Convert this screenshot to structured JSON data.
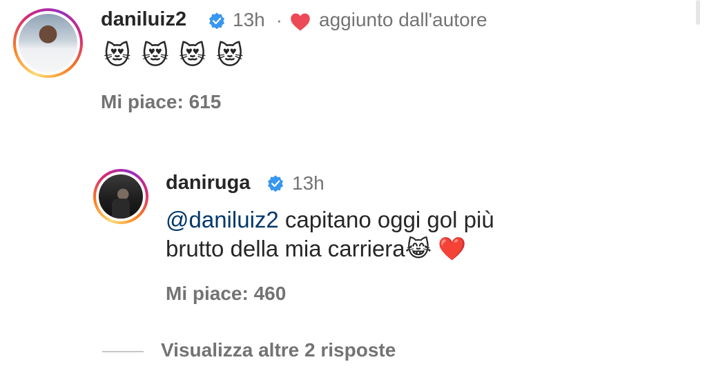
{
  "comment": {
    "username": "daniluiz2",
    "time": "13h",
    "separator": "·",
    "author_tag": "aggiunto dall'autore",
    "emojis": [
      "😻",
      "😻",
      "😻",
      "😻"
    ],
    "likes": "Mi piace: 615"
  },
  "reply": {
    "username": "daniruga",
    "time": "13h",
    "mention": "@daniluiz2",
    "text_line1": " capitano oggi gol più",
    "text_line2": "brutto della mia carriera",
    "emoji_laugh": "😹",
    "emoji_heart": "❤️",
    "likes": "Mi piace: 460"
  },
  "view_more": "Visualizza altre 2 risposte",
  "colors": {
    "verified": "#3897f0",
    "heart": "#ed4956",
    "link": "#00376b",
    "muted": "#737373"
  }
}
